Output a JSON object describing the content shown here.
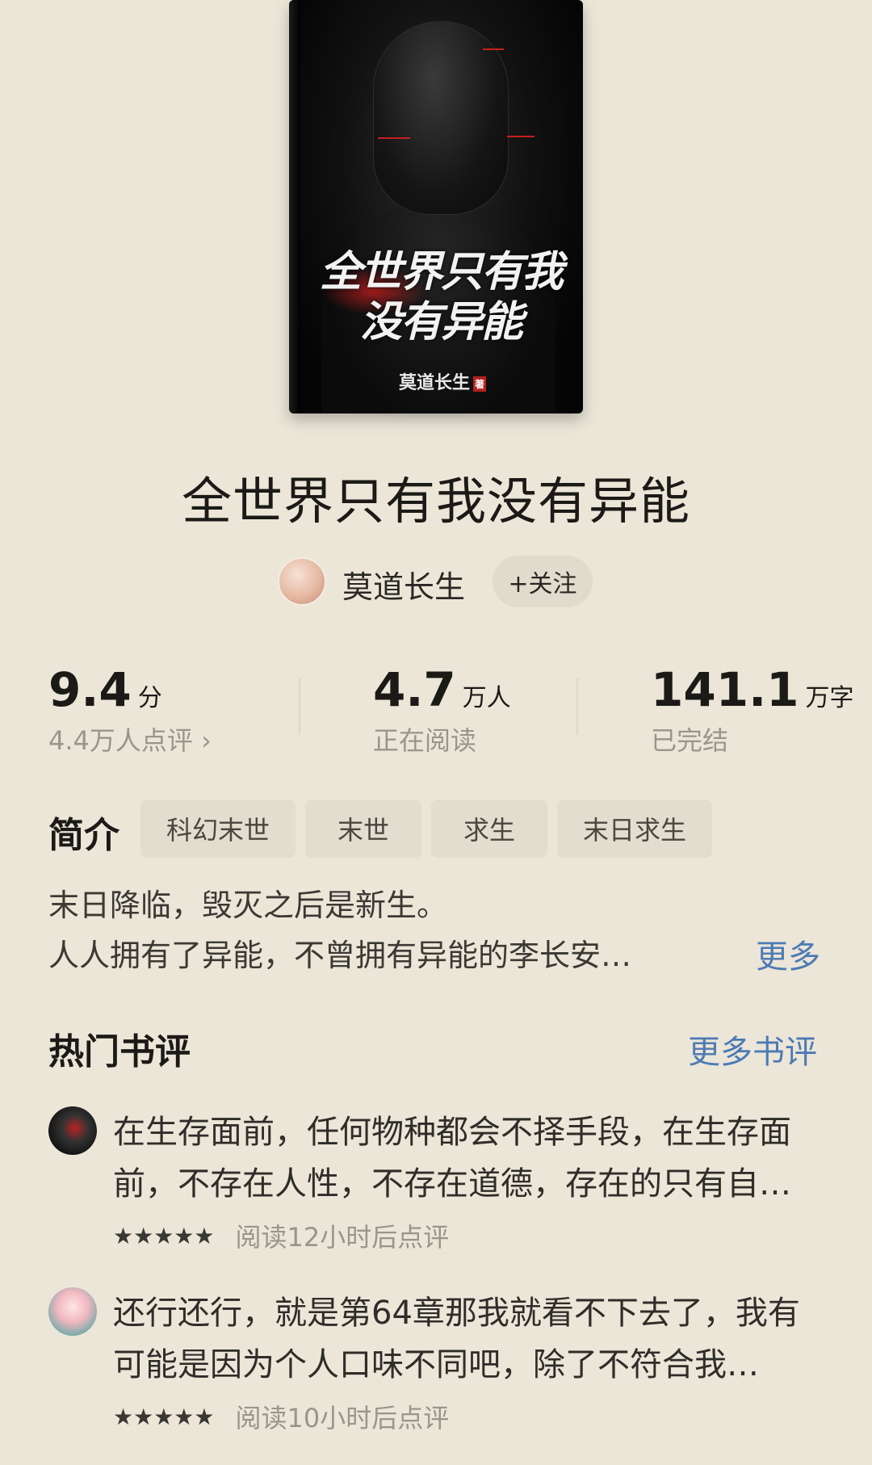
{
  "book": {
    "cover_title_line1": "全世界只有我",
    "cover_title_line2": "没有异能",
    "cover_author": "莫道长生",
    "cover_seal": "著",
    "title": "全世界只有我没有异能",
    "author": "莫道长生",
    "follow_label": "+关注"
  },
  "stats": {
    "score": {
      "value": "9.4",
      "unit": "分",
      "sub": "4.4万人点评 ›"
    },
    "readers": {
      "value": "4.7",
      "unit": "万人",
      "sub": "正在阅读"
    },
    "words": {
      "value": "141.1",
      "unit": "万字",
      "sub": "已完结"
    }
  },
  "intro": {
    "label": "简介",
    "tags": [
      "科幻末世",
      "末世",
      "求生",
      "末日求生"
    ],
    "line1": "末日降临，毁灭之后是新生。",
    "line2": "人人拥有了异能，不曾拥有异能的李长安…",
    "more": "更多"
  },
  "reviews": {
    "title": "热门书评",
    "more": "更多书评",
    "items": [
      {
        "text": "在生存面前，任何物种都会不择手段，在生存面前，不存在人性，不存在道德，存在的只有自…",
        "stars": "★★★★★",
        "info": "阅读12小时后点评"
      },
      {
        "text": "还行还行，就是第64章那我就看不下去了，我有可能是因为个人口味不同吧，除了不符合我…",
        "stars": "★★★★★",
        "info": "阅读10小时后点评"
      }
    ]
  },
  "colors": {
    "background": "#ebe6d8",
    "link": "#4d7ab4",
    "tag_bg": "#e2ddcf"
  }
}
